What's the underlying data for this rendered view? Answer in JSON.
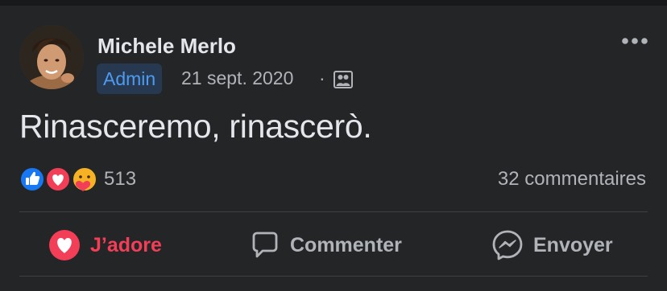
{
  "post": {
    "author": "Michele Merlo",
    "badge": "Admin",
    "date": "21 sept. 2020",
    "separator": "·",
    "audience_icon": "people-icon",
    "text": "Rinasceremo, rinascerò."
  },
  "stats": {
    "reactions": [
      "like-icon",
      "love-icon",
      "care-icon"
    ],
    "reaction_count": "513",
    "comments": "32 commentaires"
  },
  "actions": [
    {
      "label": "J’adore",
      "icon": "heart-icon",
      "color": "#f33e58"
    },
    {
      "label": "Commenter",
      "icon": "comment-icon"
    },
    {
      "label": "Envoyer",
      "icon": "messenger-icon"
    }
  ],
  "colors": {
    "background": "#242526",
    "badge_bg": "#263951",
    "badge_text": "#4e9bf0",
    "love": "#f33e58",
    "like": "#1877f2",
    "secondary_text": "#b0b3b8"
  }
}
